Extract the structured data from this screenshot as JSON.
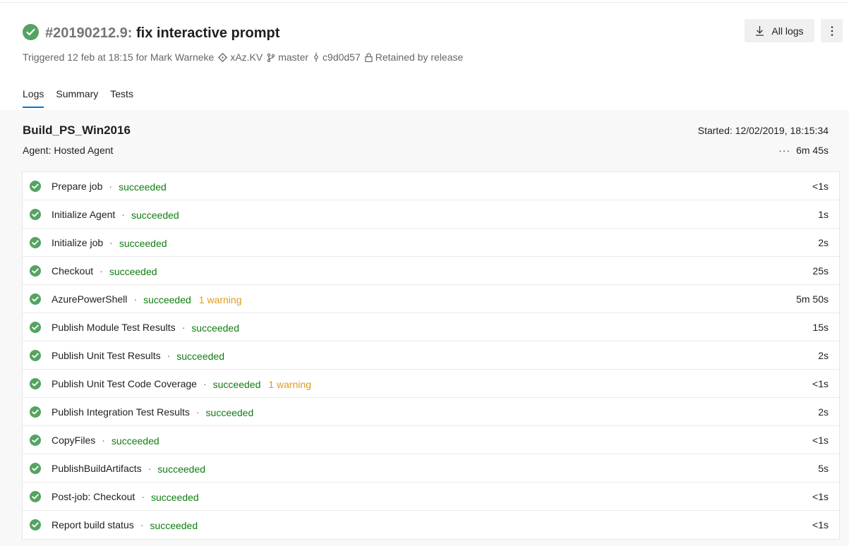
{
  "header": {
    "run_number": "#20190212.9:",
    "run_title": "fix interactive prompt",
    "trigger_text": "Triggered 12 feb at 18:15 for Mark Warneke",
    "repo": "xAz.KV",
    "branch": "master",
    "commit": "c9d0d57",
    "retention": "Retained by release",
    "all_logs_label": "All logs"
  },
  "tabs": [
    {
      "label": "Logs",
      "active": true
    },
    {
      "label": "Summary",
      "active": false
    },
    {
      "label": "Tests",
      "active": false
    }
  ],
  "job": {
    "name": "Build_PS_Win2016",
    "agent": "Agent: Hosted Agent",
    "started": "Started: 12/02/2019, 18:15:34",
    "duration": "6m 45s"
  },
  "steps": [
    {
      "name": "Prepare job",
      "result": "succeeded",
      "warning": "",
      "time": "<1s"
    },
    {
      "name": "Initialize Agent",
      "result": "succeeded",
      "warning": "",
      "time": "1s"
    },
    {
      "name": "Initialize job",
      "result": "succeeded",
      "warning": "",
      "time": "2s"
    },
    {
      "name": "Checkout",
      "result": "succeeded",
      "warning": "",
      "time": "25s"
    },
    {
      "name": "AzurePowerShell",
      "result": "succeeded",
      "warning": "1 warning",
      "time": "5m 50s"
    },
    {
      "name": "Publish Module Test Results",
      "result": "succeeded",
      "warning": "",
      "time": "15s"
    },
    {
      "name": "Publish Unit Test Results",
      "result": "succeeded",
      "warning": "",
      "time": "2s"
    },
    {
      "name": "Publish Unit Test Code Coverage",
      "result": "succeeded",
      "warning": "1 warning",
      "time": "<1s"
    },
    {
      "name": "Publish Integration Test Results",
      "result": "succeeded",
      "warning": "",
      "time": "2s"
    },
    {
      "name": "CopyFiles",
      "result": "succeeded",
      "warning": "",
      "time": "<1s"
    },
    {
      "name": "PublishBuildArtifacts",
      "result": "succeeded",
      "warning": "",
      "time": "5s"
    },
    {
      "name": "Post-job: Checkout",
      "result": "succeeded",
      "warning": "",
      "time": "<1s"
    },
    {
      "name": "Report build status",
      "result": "succeeded",
      "warning": "",
      "time": "<1s"
    }
  ],
  "colors": {
    "success": "#55a362",
    "success_text": "#107c10",
    "warning_text": "#e09b19",
    "tab_accent": "#0078d4"
  },
  "icons": {
    "status": "check-circle-icon",
    "repo": "git-repo-icon",
    "branch": "git-branch-icon",
    "commit": "git-commit-icon",
    "retention": "lock-icon",
    "download": "download-icon",
    "more": "more-vertical-icon"
  }
}
